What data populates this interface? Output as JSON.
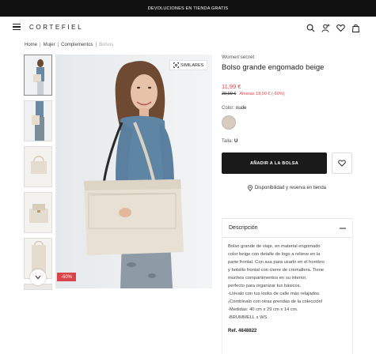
{
  "promo": {
    "text": "DEVOLUCIONES EN TIENDA GRATIS"
  },
  "header": {
    "logo": "CORTEFIEL",
    "icons": [
      "menu-icon",
      "search-icon",
      "account-icon",
      "heart-icon",
      "bag-icon"
    ]
  },
  "breadcrumb": [
    "Home",
    "Mujer",
    "Complementos",
    "Bolsos"
  ],
  "gallery": {
    "similar_label": "SIMILARES",
    "discount_badge": "-60%",
    "thumbnail_count": 6
  },
  "product": {
    "brand": "Women'secret",
    "name": "Bolso grande engomado beige",
    "price": "11,99 €",
    "old_price": "29,99 €",
    "savings": "Ahorras 18,00 € (-60%)",
    "color_label": "Color:",
    "color_value": "nude",
    "size_label": "Talla:",
    "size_value": "U",
    "add_to_bag": "AÑADIR A LA BOLSA",
    "availability": "Disponibilidad y reserva en tienda",
    "swatch_color": "#d9cbbd"
  },
  "description": {
    "title": "Descripción",
    "lines": [
      "Bolso grande de viaje, en material engomado",
      "color beige con detalle de logo a relieve en la",
      "parte frontal. Con asa para usarlo en el hombro",
      "y bolsillo frontal con cierre de cremallera. Tiene",
      "muchos compartimentos en su interior,",
      "perfecto para organizar tus básicos.",
      "-Llévalo con tus looks de calle más relajados.",
      "¡Combínalo con otras prendas de la colección!",
      "-Medidas: 40 cm x 29 cm x 14 cm.",
      "-BRUMMELL x WS."
    ],
    "ref_label": "Ref.",
    "ref_value": "4848822"
  },
  "colors": {
    "accent": "#d8464b",
    "primary_button": "#1a1a1a"
  }
}
